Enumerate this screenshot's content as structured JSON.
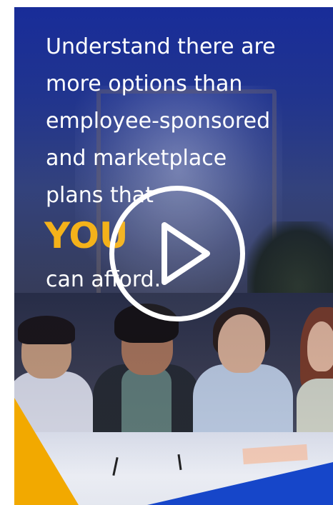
{
  "video": {
    "headline_lines": [
      "Understand there are",
      "more options than",
      "employee-sponsored",
      "and marketplace",
      "plans that"
    ],
    "highlight": "YOU",
    "tail": "can afford.",
    "highlight_color": "#f4b21a",
    "accent_yellow": "#f2a900",
    "accent_blue": "#1646c9",
    "play_icon": "play-icon"
  }
}
